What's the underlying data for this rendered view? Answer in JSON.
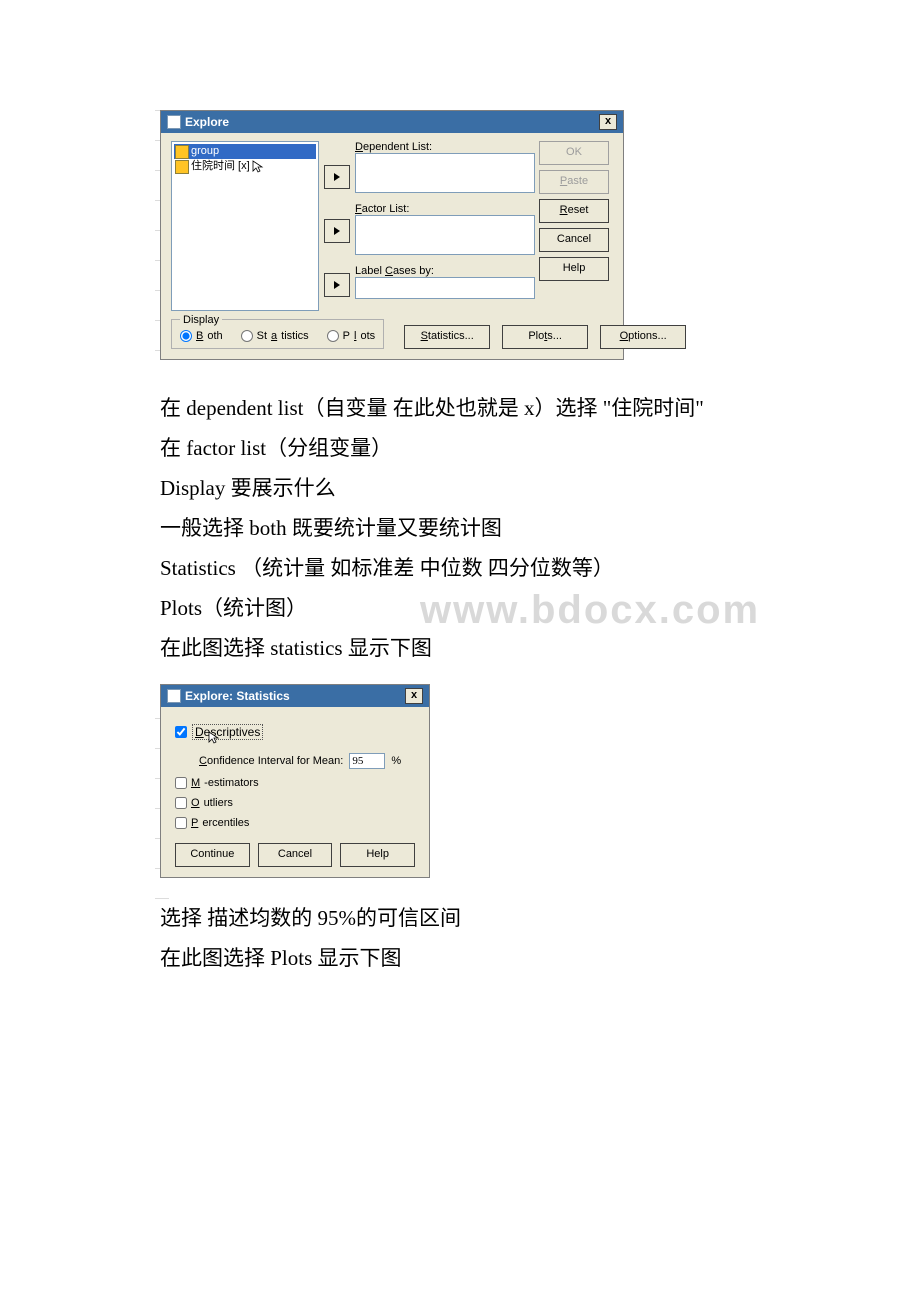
{
  "explore": {
    "title": "Explore",
    "close": "x",
    "source_items": [
      {
        "label": "group",
        "selected": true
      },
      {
        "label": "住院时间 [x]",
        "selected": false,
        "has_cursor": true
      }
    ],
    "labels": {
      "dependent": "Dependent List:",
      "factor": "Factor List:",
      "labelcases": "Label Cases by:"
    },
    "buttons": {
      "ok": "OK",
      "paste": "Paste",
      "reset": "Reset",
      "cancel": "Cancel",
      "help": "Help",
      "statistics": "Statistics...",
      "plots": "Plots...",
      "options": "Options..."
    },
    "display": {
      "legend": "Display",
      "both": "Both",
      "statistics": "Statistics",
      "plots": "Plots"
    }
  },
  "paragraphs": {
    "p1": "在 dependent list（自变量 在此处也就是 x）选择 \"住院时间\"",
    "p2": "在 factor list（分组变量）",
    "p3": "Display 要展示什么",
    "p4": "一般选择 both 既要统计量又要统计图",
    "p5": "Statistics （统计量 如标准差 中位数 四分位数等）",
    "p6": "Plots（统计图）",
    "p7": "在此图选择 statistics 显示下图",
    "p8": "选择 描述均数的 95%的可信区间",
    "p9": "在此图选择 Plots 显示下图"
  },
  "watermark": "www.bdocx.com",
  "stats": {
    "title": "Explore: Statistics",
    "close": "x",
    "descriptives": "Descriptives",
    "ci_label": "Confidence Interval for Mean:",
    "ci_value": "95",
    "ci_pct": "%",
    "m_est": "M-estimators",
    "outliers": "Outliers",
    "percentiles": "Percentiles",
    "buttons": {
      "continue": "Continue",
      "cancel": "Cancel",
      "help": "Help"
    }
  }
}
